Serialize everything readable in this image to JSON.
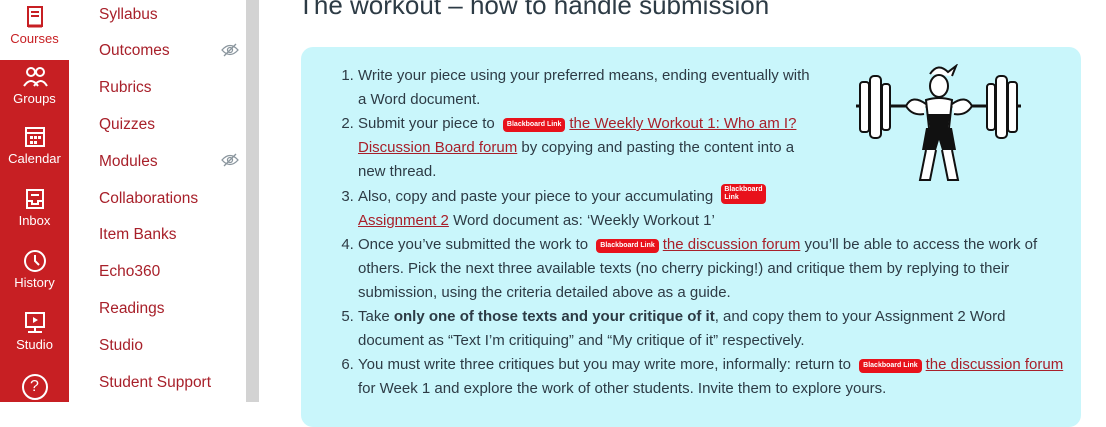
{
  "global_nav": {
    "items": [
      {
        "label": "Courses",
        "icon": "courses-icon"
      },
      {
        "label": "Groups",
        "icon": "groups-icon"
      },
      {
        "label": "Calendar",
        "icon": "calendar-icon"
      },
      {
        "label": "Inbox",
        "icon": "inbox-icon"
      },
      {
        "label": "History",
        "icon": "history-icon"
      },
      {
        "label": "Studio",
        "icon": "studio-icon"
      },
      {
        "label": "?",
        "icon": "help-icon"
      }
    ]
  },
  "course_nav": {
    "items": [
      {
        "label": "Syllabus"
      },
      {
        "label": "Outcomes",
        "hidden_icon": "eye-slash-icon"
      },
      {
        "label": "Rubrics"
      },
      {
        "label": "Quizzes"
      },
      {
        "label": "Modules",
        "hidden_icon": "eye-slash-icon"
      },
      {
        "label": "Collaborations"
      },
      {
        "label": "Item Banks"
      },
      {
        "label": "Echo360"
      },
      {
        "label": "Readings"
      },
      {
        "label": "Studio"
      },
      {
        "label": "Student Support"
      }
    ]
  },
  "main": {
    "title": "The workout – how to handle submission",
    "badge_label": "Blackboard Link",
    "badge_split_top": "Blackboard",
    "badge_split_bottom": "Link",
    "steps": {
      "s1": "Write your piece using your preferred means, ending eventually with a Word document.",
      "s2_pre": "Submit your piece to",
      "s2_link": "the Weekly Workout 1: Who am I? Discussion Board forum",
      "s2_post": "by copying and pasting the content into a new thread.",
      "s3_pre": "Also, copy and paste your piece to your accumulating",
      "s3_link": "Assignment 2",
      "s3_post": "Word document as: ‘Weekly Workout 1’",
      "s4_pre": "Once you’ve submitted the work to",
      "s4_link": "the discussion forum",
      "s4_post": "you’ll be able to access the work of others. Pick the next three available texts (no cherry picking!) and critique them by replying to their submission, using the criteria detailed above as a guide.",
      "s5_pre": "Take",
      "s5_bold": "only one of those texts and your critique of it",
      "s5_post": ", and copy them to your Assignment 2 Word document as “Text I’m critiquing” and “My critique of it” respectively.",
      "s6_pre": "You must write three critiques but you may write more, informally: return to",
      "s6_link": "the discussion forum",
      "s6_post": "for Week 1 and explore the work of other students. Invite them to explore yours."
    },
    "illustration_icon": "weightlifter-illustration"
  },
  "colors": {
    "brand_red": "#c71f23",
    "link": "#a8202a",
    "box_bg": "#c9f6fb",
    "badge": "#e8121b"
  }
}
